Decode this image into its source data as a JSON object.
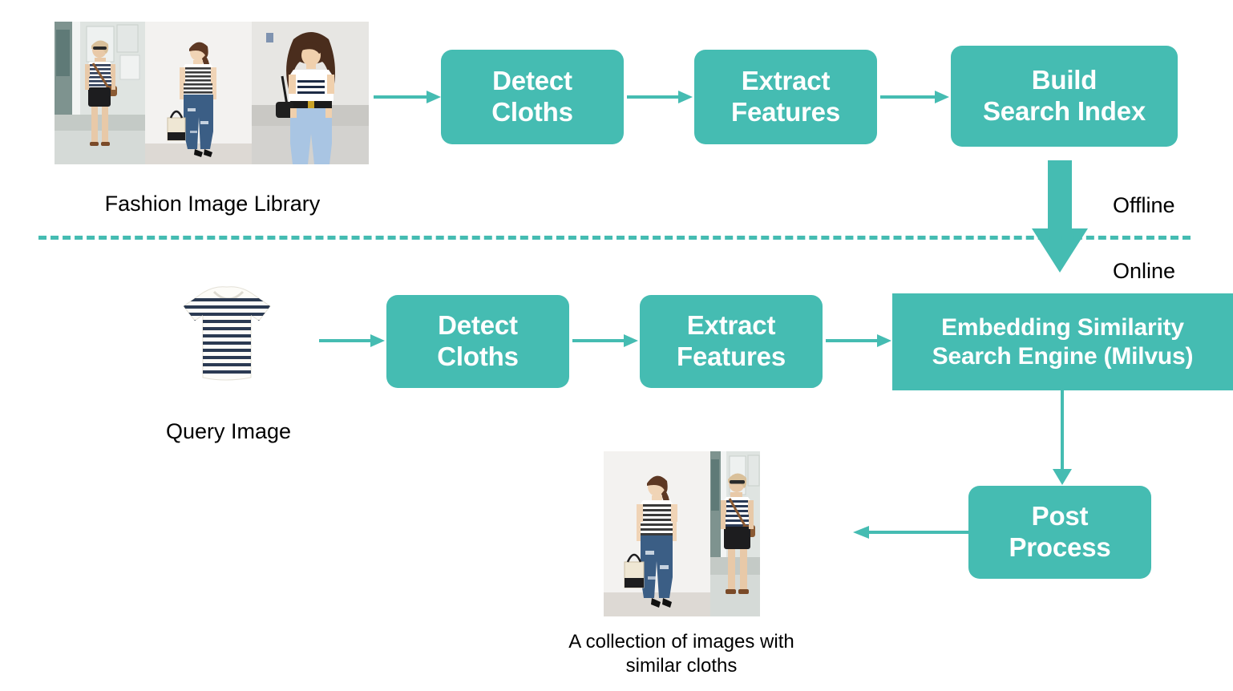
{
  "diagram": {
    "title": "Fashion image similarity search pipeline",
    "accent_color": "#45BCB2",
    "text_color": "#000000",
    "box_text_color": "#FFFFFF",
    "background": "#FFFFFF"
  },
  "offline_row": {
    "source_caption": "Fashion Image Library",
    "steps": [
      {
        "id": "detect-cloths-offline",
        "label": "Detect\nCloths"
      },
      {
        "id": "extract-features-offline",
        "label": "Extract\nFeatures"
      },
      {
        "id": "build-search-index",
        "label": "Build\nSearch Index"
      }
    ]
  },
  "online_row": {
    "source_caption": "Query Image",
    "steps": [
      {
        "id": "detect-cloths-online",
        "label": "Detect\nCloths"
      },
      {
        "id": "extract-features-online",
        "label": "Extract\nFeatures"
      },
      {
        "id": "search-engine",
        "label": "Embedding Similarity\nSearch Engine (Milvus)"
      }
    ],
    "post_process": {
      "id": "post-process",
      "label": "Post\nProcess"
    },
    "result_caption": "A collection of images with\nsimilar cloths"
  },
  "divider": {
    "above_label": "Offline",
    "below_label": "Online"
  },
  "images": {
    "library": [
      {
        "name": "woman-striped-tee-black-shorts-street",
        "alt": "Woman in striped tee and black shorts on sidewalk"
      },
      {
        "name": "woman-striped-tee-ripped-jeans-studio",
        "alt": "Woman in striped tee and ripped jeans with tote bag"
      },
      {
        "name": "woman-striped-tee-light-jeans-street",
        "alt": "Woman in striped top and light blue jeans with belt"
      }
    ],
    "query": {
      "name": "striped-tshirt-product",
      "alt": "Navy and white striped t-shirt on white background"
    },
    "results": [
      {
        "name": "woman-striped-tee-ripped-jeans-studio",
        "alt": "Woman in striped tee and ripped jeans with tote bag"
      },
      {
        "name": "woman-striped-tee-black-shorts-street",
        "alt": "Woman in striped tee and black shorts on sidewalk"
      }
    ]
  }
}
